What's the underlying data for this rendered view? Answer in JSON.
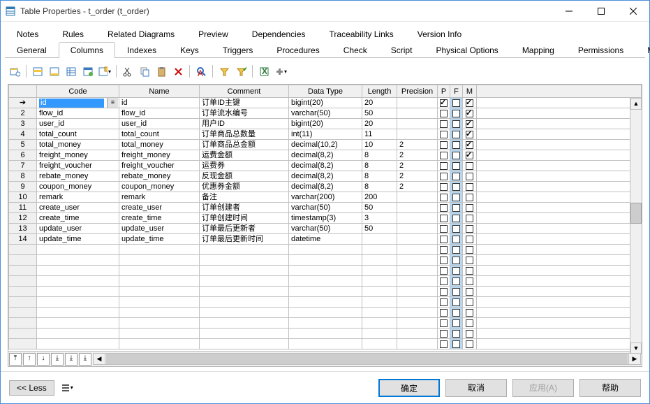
{
  "window": {
    "title": "Table Properties - t_order (t_order)"
  },
  "tabsTop": [
    "Notes",
    "Rules",
    "Related Diagrams",
    "Preview",
    "Dependencies",
    "Traceability Links",
    "Version Info"
  ],
  "tabsBottom": [
    "General",
    "Columns",
    "Indexes",
    "Keys",
    "Triggers",
    "Procedures",
    "Check",
    "Script",
    "Physical Options",
    "Mapping",
    "Permissions",
    "MySQL"
  ],
  "activeTab": "Columns",
  "headers": [
    "",
    "Code",
    "Name",
    "Comment",
    "Data Type",
    "Length",
    "Precision",
    "P",
    "F",
    "M"
  ],
  "rows": [
    {
      "n": "",
      "arrow": true,
      "code": "id",
      "name": "id",
      "comment": "订单ID主键",
      "dtype": "bigint(20)",
      "len": "20",
      "prec": "",
      "p": true,
      "f": false,
      "m": true,
      "edit": true
    },
    {
      "n": "2",
      "code": "flow_id",
      "name": "flow_id",
      "comment": "订单流水编号",
      "dtype": "varchar(50)",
      "len": "50",
      "prec": "",
      "p": false,
      "f": false,
      "m": true
    },
    {
      "n": "3",
      "code": "user_id",
      "name": "user_id",
      "comment": "用户ID",
      "dtype": "bigint(20)",
      "len": "20",
      "prec": "",
      "p": false,
      "f": false,
      "m": true
    },
    {
      "n": "4",
      "code": "total_count",
      "name": "total_count",
      "comment": "订单商品总数量",
      "dtype": "int(11)",
      "len": "11",
      "prec": "",
      "p": false,
      "f": false,
      "m": true
    },
    {
      "n": "5",
      "code": "total_money",
      "name": "total_money",
      "comment": "订单商品总金额",
      "dtype": "decimal(10,2)",
      "len": "10",
      "prec": "2",
      "p": false,
      "f": false,
      "m": true
    },
    {
      "n": "6",
      "code": "freight_money",
      "name": "freight_money",
      "comment": "运费金额",
      "dtype": "decimal(8,2)",
      "len": "8",
      "prec": "2",
      "p": false,
      "f": false,
      "m": true
    },
    {
      "n": "7",
      "code": "freight_voucher",
      "name": "freight_voucher",
      "comment": "运费券",
      "dtype": "decimal(8,2)",
      "len": "8",
      "prec": "2",
      "p": false,
      "f": false,
      "m": false
    },
    {
      "n": "8",
      "code": "rebate_money",
      "name": "rebate_money",
      "comment": "反现金额",
      "dtype": "decimal(8,2)",
      "len": "8",
      "prec": "2",
      "p": false,
      "f": false,
      "m": false
    },
    {
      "n": "9",
      "code": "coupon_money",
      "name": "coupon_money",
      "comment": "优惠券金额",
      "dtype": "decimal(8,2)",
      "len": "8",
      "prec": "2",
      "p": false,
      "f": false,
      "m": false
    },
    {
      "n": "10",
      "code": "remark",
      "name": "remark",
      "comment": "备注",
      "dtype": "varchar(200)",
      "len": "200",
      "prec": "",
      "p": false,
      "f": false,
      "m": false
    },
    {
      "n": "11",
      "code": "create_user",
      "name": "create_user",
      "comment": "订单创建者",
      "dtype": "varchar(50)",
      "len": "50",
      "prec": "",
      "p": false,
      "f": false,
      "m": false
    },
    {
      "n": "12",
      "code": "create_time",
      "name": "create_time",
      "comment": "订单创建时间",
      "dtype": "timestamp(3)",
      "len": "3",
      "prec": "",
      "p": false,
      "f": false,
      "m": false
    },
    {
      "n": "13",
      "code": "update_user",
      "name": "update_user",
      "comment": "订单最后更新者",
      "dtype": "varchar(50)",
      "len": "50",
      "prec": "",
      "p": false,
      "f": false,
      "m": false
    },
    {
      "n": "14",
      "code": "update_time",
      "name": "update_time",
      "comment": "订单最后更新时间",
      "dtype": "datetime",
      "len": "",
      "prec": "",
      "p": false,
      "f": false,
      "m": false
    }
  ],
  "emptyRows": 10,
  "buttons": {
    "less": "<< Less",
    "ok": "确定",
    "cancel": "取消",
    "apply": "应用(A)",
    "help": "帮助"
  }
}
